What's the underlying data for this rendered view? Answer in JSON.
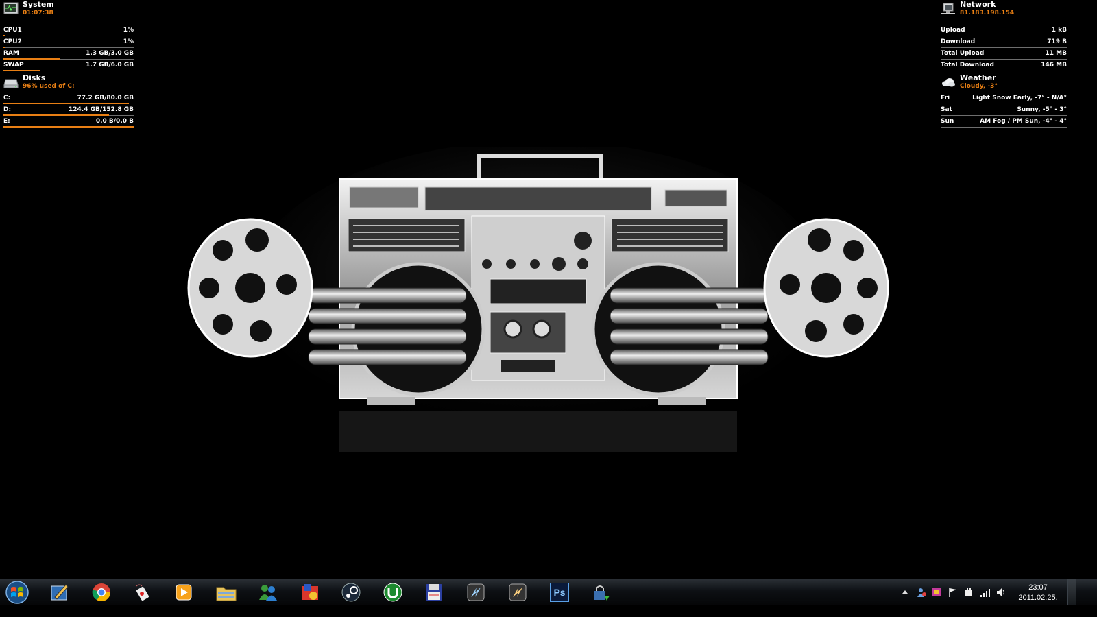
{
  "system": {
    "title": "System",
    "uptime": "01:07:38",
    "rows": [
      {
        "label": "CPU1",
        "value": "1%",
        "fill": 0.01
      },
      {
        "label": "CPU2",
        "value": "1%",
        "fill": 0.01
      },
      {
        "label": "RAM",
        "value": "1.3 GB/3.0 GB",
        "fill": 0.43
      },
      {
        "label": "SWAP",
        "value": "1.7 GB/6.0 GB",
        "fill": 0.28
      }
    ]
  },
  "disks": {
    "title": "Disks",
    "subtitle": "96% used of C:",
    "rows": [
      {
        "label": "C:",
        "value": "77.2 GB/80.0 GB",
        "fill": 0.965
      },
      {
        "label": "D:",
        "value": "124.4 GB/152.8 GB",
        "fill": 0.81
      },
      {
        "label": "E:",
        "value": "0.0 B/0.0 B",
        "fill": 1.0
      }
    ]
  },
  "network": {
    "title": "Network",
    "ip": "81.183.198.154",
    "rows": [
      {
        "label": "Upload",
        "value": "1 kB"
      },
      {
        "label": "Download",
        "value": "719 B"
      },
      {
        "label": "Total Upload",
        "value": "11 MB"
      },
      {
        "label": "Total Download",
        "value": "146 MB"
      }
    ]
  },
  "weather": {
    "title": "Weather",
    "current": "Cloudy, -3°",
    "rows": [
      {
        "label": "Fri",
        "value": "Light Snow Early, -7° - N/A°"
      },
      {
        "label": "Sat",
        "value": "Sunny, -5° - 3°"
      },
      {
        "label": "Sun",
        "value": "AM Fog / PM Sun, -4° - 4°"
      }
    ]
  },
  "taskbar": {
    "start_icon": "windows-start-orb",
    "pinned": [
      {
        "name": "notepad-pen-icon"
      },
      {
        "name": "chrome-icon"
      },
      {
        "name": "usb-device-icon"
      },
      {
        "name": "media-player-icon"
      },
      {
        "name": "file-explorer-icon"
      },
      {
        "name": "messenger-icon"
      },
      {
        "name": "game-app-icon"
      },
      {
        "name": "steam-icon"
      },
      {
        "name": "utorrent-icon"
      },
      {
        "name": "floppy-save-icon"
      },
      {
        "name": "app-shortcut-icon-1"
      },
      {
        "name": "app-shortcut-icon-2"
      },
      {
        "name": "photoshop-icon",
        "text": "Ps"
      },
      {
        "name": "lock-network-icon"
      }
    ],
    "clock": {
      "time": "23:07",
      "date": "2011.02.25."
    }
  },
  "colors": {
    "accent": "#e87f14",
    "divider": "#6e6e6e",
    "background": "#000000"
  }
}
